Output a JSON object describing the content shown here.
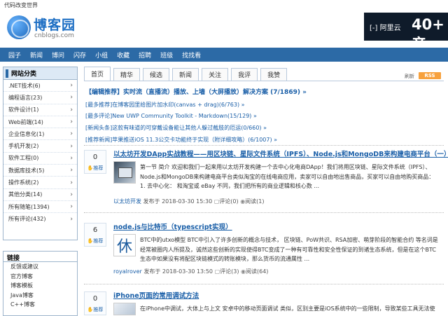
{
  "header": {
    "slogan": "代码改变世界",
    "logo_title": "博客园",
    "logo_subtitle": "cnblogs.com"
  },
  "ad": {
    "brand": "[-] 阿里云",
    "promo": "40+ 产"
  },
  "nav": [
    "园子",
    "新闻",
    "博问",
    "闪存",
    "小组",
    "收藏",
    "招聘",
    "班级",
    "找找看"
  ],
  "sidebar": {
    "title": "网站分类",
    "items": [
      ".NET技术(6)",
      "编程语言(23)",
      "软件设计(1)",
      "Web前端(14)",
      "企业信息化(1)",
      "手机开发(2)",
      "软件工程(0)",
      "数据库技术(5)",
      "操作系统(2)",
      "其他分类(14)",
      "所有随笔(1394)",
      "所有评论(432)"
    ]
  },
  "links": {
    "title": "链接",
    "items": [
      "反馈或建议",
      "官方博客",
      "博客模板",
      "Java博客",
      "C++博客"
    ]
  },
  "tabs": [
    "首页",
    "精华",
    "候选",
    "新闻",
    "关注",
    "我评",
    "我赞"
  ],
  "refresh": "刷新",
  "rss": "RSS",
  "editor_pick": "【编辑推荐】实时流（直播流）播放、上墙（大屏播放）解决方案 (7/1869) »",
  "recommendations": [
    "[最多推荐]在博客园里给图片加水印(canvas + drag)(6/763) »",
    "[最多评论]New UWP Community Toolkit - Markdown(15/129) »",
    "[新闻头条]这款有味道的可穿戴设备能让其他人躲过截肢的厄运(0/660) »",
    "[推荐新闻]苹果推送iOS 11.3公交卡功能终于实现（附详细攻略）(6/1007) »"
  ],
  "posts": [
    {
      "votes": "0",
      "vote_label": "推荐",
      "title": "以太坊开发DApp实战教程——用区块链、星际文件系统（IPFS）、Node.js和MongoDB来构建电商平台（一）",
      "summary": "第一节 简介 欢迎和我们一起来用以太坊开发构建一个去中心化电商DApp！我们将用区块链、星际文件系统（IPFS）、Node.js和MongoDB来构建电商平台类似淘宝的在线电商应用，卖家可以自由地出售商品，买家可以自由地购买商品：  1. 去中心化：  和淘宝或 eBay 不同，我们把所有的商业逻辑和核心数 ...",
      "author": "以太坊开发",
      "posted": "发布于 2018-03-30 15:30",
      "comments": "评论(0)",
      "reads": "阅读(1)"
    },
    {
      "votes": "6",
      "vote_label": "推荐",
      "title": "node.js与比特币（typescript实现）",
      "image_char": "休",
      "summary": "BTC中的utxo模型 BTC中引入了许多创新的概念与技术， 区块链、PoW共识、RSA加密、萌芽阶段的智能合约 等名词是经常被圈内人所提及，诚然这些创新的实现使得BTC变成了一种有可靠性和安全性保证的到诸生态系统，但是在这个BTC生态中如果没有将配区块链模式的转账模块，那么货币的流通属性 ...",
      "author": "royalrover",
      "posted": "发布于 2018-03-30 13:50",
      "comments": "评论(3)",
      "reads": "阅读(64)"
    },
    {
      "votes": "0",
      "vote_label": "推荐",
      "title": "iPhone页面的常用调试方法",
      "summary": "在iPhone中调试，大体上与上文 安卓中的移动页面调试 类似，区别主要是iOS系统中的一些限制，导致某些工具无法使"
    }
  ],
  "colors": {
    "nav_bg": "#2c6aa6",
    "link": "#1a5fa8",
    "rss": "#f7a13d"
  }
}
